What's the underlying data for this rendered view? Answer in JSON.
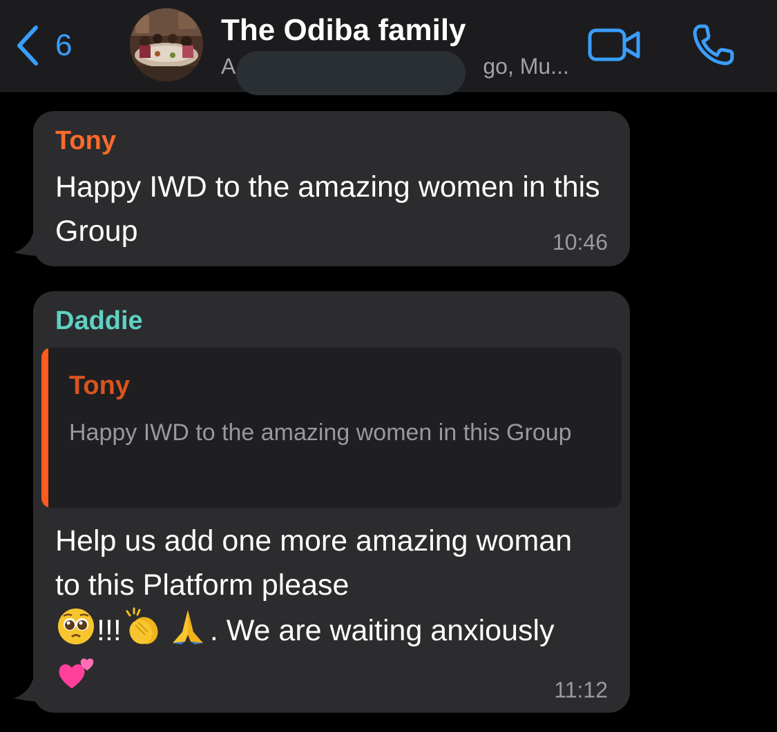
{
  "header": {
    "back_count": "6",
    "title": "The Odiba family",
    "subtitle_start": "A",
    "subtitle_end": "go, Mu...",
    "back_icon": "chevron-left-icon",
    "video_icon": "video-camera-icon",
    "call_icon": "phone-icon"
  },
  "colors": {
    "accent": "#3a9eff",
    "header_bg": "#1c1c1e",
    "bubble_bg": "#2c2c2e",
    "tony": "#ff6a2b",
    "daddie": "#5fd1c4"
  },
  "messages": [
    {
      "sender": "Tony",
      "text": "Happy IWD to the amazing women in this Group",
      "time": "10:46"
    },
    {
      "sender": "Daddie",
      "reply_to": {
        "sender": "Tony",
        "text": "Happy IWD to the amazing women in this Group"
      },
      "text_line1": "Help us add one more amazing woman to this Platform please",
      "text_mid": "!!!",
      "text_line3": ". We are waiting anxiously",
      "emojis": [
        "pleading-face-icon",
        "clapping-hands-icon",
        "folded-hands-icon",
        "two-hearts-icon"
      ],
      "time": "11:12"
    }
  ]
}
